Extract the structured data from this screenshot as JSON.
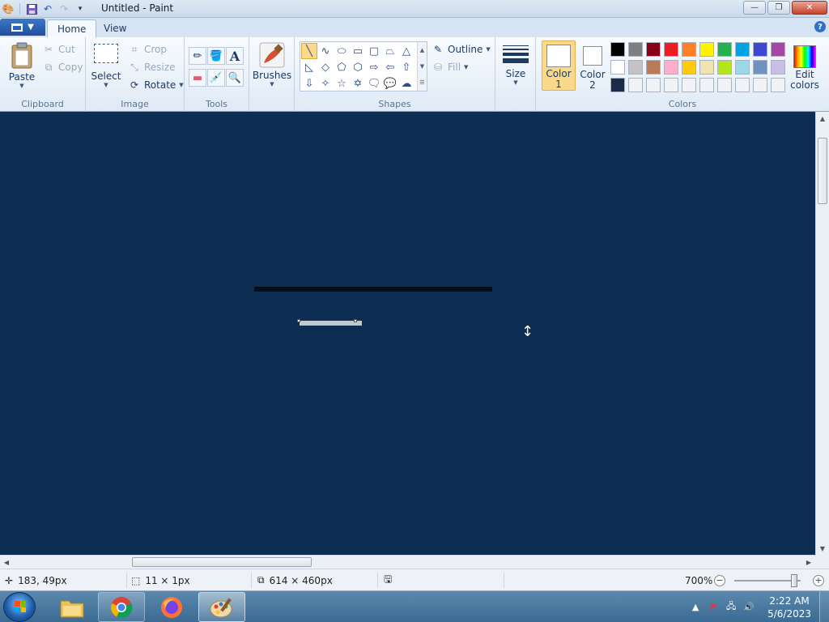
{
  "window": {
    "title": "Untitled - Paint",
    "controls": {
      "minimize": "—",
      "restore": "❐",
      "close": "✕"
    }
  },
  "ribbon_tabs": [
    {
      "label": "Home",
      "active": true
    },
    {
      "label": "View",
      "active": false
    }
  ],
  "help_label": "?",
  "groups": {
    "clipboard": {
      "label": "Clipboard",
      "paste": "Paste",
      "cut": "Cut",
      "copy": "Copy"
    },
    "image": {
      "label": "Image",
      "select": "Select",
      "crop": "Crop",
      "resize": "Resize",
      "rotate": "Rotate"
    },
    "tools": {
      "label": "Tools",
      "items": [
        "pencil",
        "fill",
        "text",
        "eraser",
        "color-picker",
        "magnifier"
      ],
      "text_glyph": "A"
    },
    "brushes": {
      "label": "Brushes"
    },
    "shapes": {
      "label": "Shapes",
      "outline": "Outline",
      "fill": "Fill",
      "selected_shape": "line"
    },
    "size": {
      "label": "Size"
    },
    "colors": {
      "label": "Colors",
      "color1_label": "Color",
      "color1_num": "1",
      "color2_label": "Color",
      "color2_num": "2",
      "color1_value": "#ffffff",
      "color2_value": "#ffffff",
      "edit_label": "Edit",
      "edit_label2": "colors",
      "palette": [
        [
          "#000000",
          "#7f7f7f",
          "#880015",
          "#ed1c24",
          "#ff7f27",
          "#fff200",
          "#22b14c",
          "#00a2e8",
          "#3f48cc",
          "#a349a4"
        ],
        [
          "#ffffff",
          "#c3c3c3",
          "#b97a57",
          "#ffaec9",
          "#ffc90e",
          "#efe4b0",
          "#b5e61d",
          "#99d9ea",
          "#7092be",
          "#c8bfe7"
        ],
        [
          "#1a2c47",
          "#f0f2f5",
          "#f0f2f5",
          "#f0f2f5",
          "#f0f2f5",
          "#f0f2f5",
          "#f0f2f5",
          "#f0f2f5",
          "#f0f2f5",
          "#f0f2f5"
        ]
      ]
    }
  },
  "canvas": {
    "background": "#0e2d52",
    "stroke_dark": "#050d18",
    "stroke_light": "#c3c8cf"
  },
  "status": {
    "cursor_pos": "183, 49px",
    "selection_size": "11 × 1px",
    "image_size": "614 × 460px",
    "zoom": "700%"
  },
  "taskbar": {
    "apps": [
      "file-explorer",
      "chrome",
      "firefox",
      "paint"
    ],
    "time": "2:22 AM",
    "date": "5/6/2023"
  }
}
